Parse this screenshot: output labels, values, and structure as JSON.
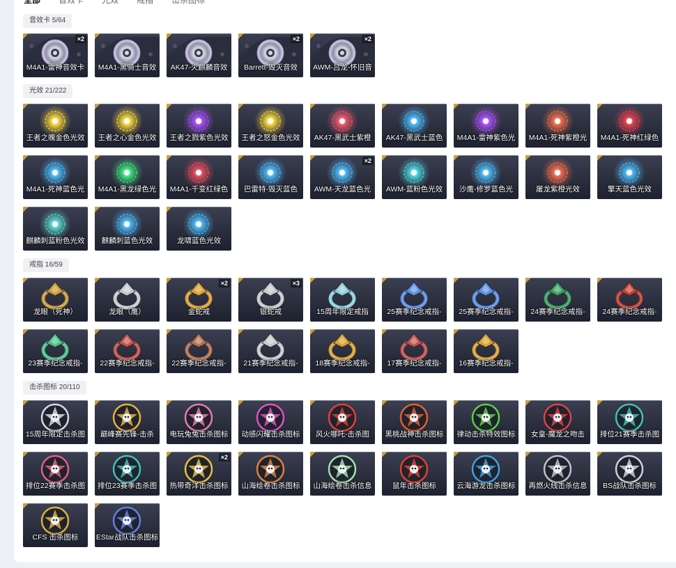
{
  "tabs": [
    {
      "label": "全部",
      "active": true
    },
    {
      "label": "音效卡",
      "active": false
    },
    {
      "label": "光效",
      "active": false
    },
    {
      "label": "戒指",
      "active": false
    },
    {
      "label": "击杀图标",
      "active": false
    }
  ],
  "sections": [
    {
      "title": "音效卡 5/64",
      "kind": "disc",
      "items": [
        {
          "name": "M4A1-雷神音效卡",
          "badge": "×2",
          "icon": "cd-disc-icon"
        },
        {
          "name": "M4A1-黑骑士音效",
          "badge": "",
          "icon": "cd-disc-icon"
        },
        {
          "name": "AK47-火麒麟音效",
          "badge": "",
          "icon": "cd-disc-icon"
        },
        {
          "name": "Barrett-毁灭音效",
          "badge": "×2",
          "icon": "cd-disc-icon"
        },
        {
          "name": "AWM-吕龙-怀旧音",
          "badge": "×2",
          "icon": "cd-disc-icon"
        }
      ]
    },
    {
      "title": "光效 21/222",
      "kind": "orb",
      "items": [
        {
          "name": "王者之魄金色光效",
          "badge": "",
          "color": "#f2d03a"
        },
        {
          "name": "王者之心金色光效",
          "badge": "",
          "color": "#f2d03a"
        },
        {
          "name": "王者之戮紫色光效",
          "badge": "",
          "color": "#a64df0"
        },
        {
          "name": "王者之怒金色光效",
          "badge": "",
          "color": "#f2d03a"
        },
        {
          "name": "AK47-黑武士紫橙",
          "badge": "",
          "color": "#e8556a"
        },
        {
          "name": "AK47-黑武士蓝色",
          "badge": "",
          "color": "#4ab4f0"
        },
        {
          "name": "M4A1-雷神紫色光",
          "badge": "",
          "color": "#a64df0"
        },
        {
          "name": "M4A1-死神紫橙光",
          "badge": "",
          "color": "#ea6a4a"
        },
        {
          "name": "M4A1-死神红绿色",
          "badge": "",
          "color": "#e0404a"
        },
        {
          "name": "M4A1-死神蓝色光",
          "badge": "",
          "color": "#4ab4f0"
        },
        {
          "name": "M4A1-黑龙绿色光",
          "badge": "",
          "color": "#3ee07a"
        },
        {
          "name": "M4A1-千变红绿色",
          "badge": "",
          "color": "#e04c5a"
        },
        {
          "name": "巴雷特-毁灭蓝色",
          "badge": "",
          "color": "#4ab4f0"
        },
        {
          "name": "AWM-天龙蓝色光",
          "badge": "×2",
          "color": "#4ab4f0"
        },
        {
          "name": "AWM-蓝粉色光效",
          "badge": "",
          "color": "#4ad0d8"
        },
        {
          "name": "沙鹰-修罗蓝色光",
          "badge": "",
          "color": "#4ab4f0"
        },
        {
          "name": "屠龙紫橙光效",
          "badge": "",
          "color": "#ea6a4a"
        },
        {
          "name": "擎天蓝色光效",
          "badge": "",
          "color": "#4ab4f0"
        },
        {
          "name": "麒麟刺蓝粉色光效",
          "badge": "",
          "color": "#5ad0c8"
        },
        {
          "name": "麒麟刺蓝色光效",
          "badge": "",
          "color": "#4ab4f0"
        },
        {
          "name": "龙啸蓝色光效",
          "badge": "",
          "color": "#4ab4f0"
        }
      ]
    },
    {
      "title": "戒指 16/59",
      "kind": "ring",
      "items": [
        {
          "name": "龙眼（死神）",
          "badge": "",
          "color": "#c99a3a"
        },
        {
          "name": "龙眼（鹰）",
          "badge": "",
          "color": "#c8c8cc"
        },
        {
          "name": "金蛇戒",
          "badge": "×2",
          "color": "#d9a032"
        },
        {
          "name": "银蛇戒",
          "badge": "×3",
          "color": "#c8c8cc"
        },
        {
          "name": "15周年限定戒指",
          "badge": "",
          "color": "#8fd0d8"
        },
        {
          "name": "25赛季纪念戒指-",
          "badge": "",
          "color": "#5a8ee0"
        },
        {
          "name": "25赛季纪念戒指-",
          "badge": "",
          "color": "#5a8ee0"
        },
        {
          "name": "24赛季纪念戒指-",
          "badge": "",
          "color": "#3aa060"
        },
        {
          "name": "24赛季纪念戒指-",
          "badge": "",
          "color": "#c04030"
        },
        {
          "name": "23赛季纪念戒指-",
          "badge": "",
          "color": "#4ac08a"
        },
        {
          "name": "22赛季纪念戒指-",
          "badge": "",
          "color": "#c0504a"
        },
        {
          "name": "22赛季纪念戒指-",
          "badge": "",
          "color": "#b07050"
        },
        {
          "name": "21赛季纪念戒指-",
          "badge": "",
          "color": "#c8c8cc"
        },
        {
          "name": "18赛季纪念戒指-",
          "badge": "",
          "color": "#d9a032"
        },
        {
          "name": "17赛季纪念戒指-",
          "badge": "",
          "color": "#c0504a"
        },
        {
          "name": "16赛季纪念戒指-",
          "badge": "",
          "color": "#d9a032"
        }
      ]
    },
    {
      "title": "击杀图标 20/110",
      "kind": "emblem",
      "items": [
        {
          "name": "15周年限定击杀图",
          "badge": "",
          "color": "#d8d8e0"
        },
        {
          "name": "巅峰赛先锋-击杀",
          "badge": "",
          "color": "#e8b040"
        },
        {
          "name": "电玩兔兔击杀图标",
          "badge": "",
          "color": "#e87ab0"
        },
        {
          "name": "动感闪耀击杀图标",
          "badge": "",
          "color": "#e050c0"
        },
        {
          "name": "风火哪吒-击杀图",
          "badge": "",
          "color": "#e04030"
        },
        {
          "name": "黑桃战神击杀图标",
          "badge": "",
          "color": "#e06030"
        },
        {
          "name": "律动击杀特效图标",
          "badge": "",
          "color": "#5ad040"
        },
        {
          "name": "女皇-魔龙之吻击",
          "badge": "",
          "color": "#e04040"
        },
        {
          "name": "排位21赛季击杀图",
          "badge": "",
          "color": "#40c0b0"
        },
        {
          "name": "排位22赛季击杀图",
          "badge": "",
          "color": "#e06080"
        },
        {
          "name": "排位23赛季击杀图",
          "badge": "",
          "color": "#40c0b0"
        },
        {
          "name": "热带奇洋击杀图标",
          "badge": "×2",
          "color": "#e8c040"
        },
        {
          "name": "山海绘卷击杀图标",
          "badge": "",
          "color": "#e08040"
        },
        {
          "name": "山海绘卷击杀信息",
          "badge": "",
          "color": "#a0e0b0"
        },
        {
          "name": "鼠年击杀图标",
          "badge": "",
          "color": "#e04030"
        },
        {
          "name": "云海游龙击杀图标",
          "badge": "",
          "color": "#40a0e0"
        },
        {
          "name": "再燃火线击杀信息",
          "badge": "",
          "color": "#c0c0c8"
        },
        {
          "name": "BS战队击杀图标",
          "badge": "",
          "color": "#d0d0d8"
        },
        {
          "name": "CFS 击杀图标",
          "badge": "",
          "color": "#d9b040"
        },
        {
          "name": "EStar战队击杀图标",
          "badge": "",
          "color": "#6080e0"
        }
      ]
    }
  ]
}
